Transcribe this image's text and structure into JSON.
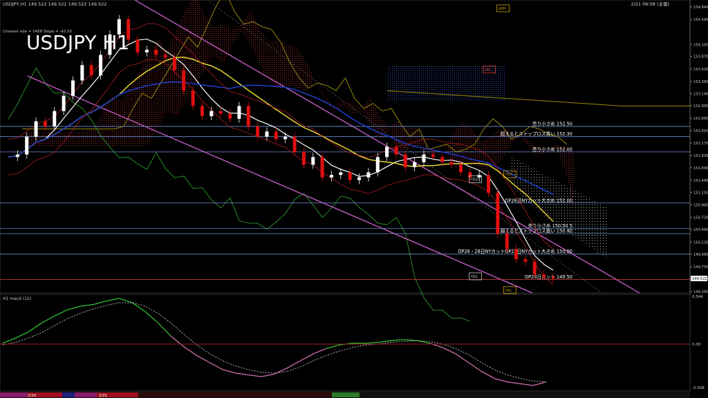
{
  "header": {
    "symbol_info": "USDJPY,H1  149.522 149.522 149.522 149.522",
    "datetime": "2/21 06:08 (主価)",
    "big_title": "USDJPY H1",
    "channel_info": "Channel size = 1458 Slope = -42.55"
  },
  "sub_panel": {
    "label": "H1   macd (12)",
    "ticks": [
      "0.544",
      "0.00",
      "-0.508"
    ]
  },
  "bottom_bar": {
    "dates": [
      "2/20",
      "2/21"
    ]
  },
  "chart_data": [
    {
      "type": "candlestick",
      "symbol": "USDJPY",
      "timeframe": "H1",
      "ylim": [
        149.265,
        154.84
      ],
      "y_ticks": [
        154.84,
        154.595,
        154.105,
        153.87,
        153.625,
        153.38,
        153.14,
        152.905,
        152.66,
        152.415,
        152.175,
        151.93,
        151.69,
        151.445,
        151.21,
        150.965,
        150.72,
        150.48,
        150.235,
        149.995,
        149.75,
        149.522,
        149.265
      ],
      "y_tick_labels": [
        "154.840",
        "154.595",
        "154.105",
        "153.870",
        "153.625",
        "153.380",
        "153.140",
        "152.905",
        "152.660",
        "152.415",
        "152.175",
        "151.930",
        "151.690",
        "151.445",
        "151.210",
        "150.965",
        "150.720",
        "150.480",
        "150.235",
        "149.995",
        "149.750",
        "149.522",
        "149.265"
      ],
      "current_price": 149.522,
      "price_path": [
        151.9,
        151.95,
        152.3,
        152.6,
        152.5,
        152.8,
        153.1,
        153.4,
        153.7,
        153.5,
        153.9,
        154.3,
        154.6,
        154.2,
        153.95,
        154.0,
        153.9,
        153.85,
        153.6,
        153.2,
        152.9,
        152.7,
        152.8,
        152.75,
        152.65,
        152.9,
        152.5,
        152.3,
        152.4,
        152.25,
        152.3,
        152.0,
        151.75,
        151.9,
        151.5,
        151.55,
        151.6,
        151.45,
        151.5,
        151.6,
        151.9,
        152.1,
        151.95,
        151.7,
        151.8,
        151.95,
        151.9,
        151.8,
        151.75,
        151.6,
        151.5,
        151.55,
        151.2,
        150.4,
        150.1,
        149.9,
        149.85,
        149.6,
        149.55,
        149.52
      ],
      "levels": [
        {
          "price": 152.5,
          "label": "売り小さめ 152.50",
          "color": "#6e8fd8"
        },
        {
          "price": 152.3,
          "label": "超えるとストップロス買い 152.30",
          "color": "#6e8fd8"
        },
        {
          "price": 152.0,
          "label": "売り小さめ 152.00",
          "color": "#6e8fd8"
        },
        {
          "price": 151.0,
          "label": "OP26日NYカット大きめ 151.00",
          "color": "#6e8fd8"
        },
        {
          "price": 150.5,
          "label": "売り小さめ 150.50  5",
          "color": "#6e8fd8"
        },
        {
          "price": 150.4,
          "label": "超えるとストップロス買い 150.40",
          "color": "#6e8fd8"
        },
        {
          "price": 150.0,
          "label": "OP26・28日NYカットOP27日NYカット大きめ 150.00",
          "color": "#6e8fd8"
        },
        {
          "price": 149.5,
          "label": "OP28日カット 149.50",
          "color": "#e04040"
        }
      ],
      "box_labels": [
        {
          "text": "LWH",
          "price": 154.8,
          "x_frac": 0.72,
          "color": "#c8a000"
        },
        {
          "text": "LWL",
          "price": 153.6,
          "x_frac": 0.7,
          "color": "#e04040"
        },
        {
          "text": "YDH",
          "price": 151.55,
          "x_frac": 0.73,
          "color": "#c8a000"
        },
        {
          "text": "YDO",
          "price": 151.45,
          "x_frac": 0.68,
          "color": "#cccccc"
        },
        {
          "text": "YDC",
          "price": 149.55,
          "x_frac": 0.68,
          "color": "#cccccc"
        },
        {
          "text": "YDL",
          "price": 149.28,
          "x_frac": 0.73,
          "color": "#c8a000"
        }
      ]
    },
    {
      "type": "line",
      "name": "macd (12)",
      "ylim": [
        -0.508,
        0.544
      ],
      "series": [
        {
          "values": [
            0.02,
            0.08,
            0.15,
            0.25,
            0.33,
            0.4,
            0.44,
            0.46,
            0.5,
            0.53,
            0.48,
            0.38,
            0.25,
            0.1,
            -0.02,
            -0.12,
            -0.2,
            -0.28,
            -0.32,
            -0.34,
            -0.36,
            -0.33,
            -0.26,
            -0.18,
            -0.1,
            -0.04,
            0.0,
            0.02,
            0.02,
            0.03,
            0.05,
            0.06,
            0.05,
            0.02,
            -0.03,
            -0.1,
            -0.2,
            -0.3,
            -0.38,
            -0.42,
            -0.44,
            -0.46,
            -0.42
          ]
        },
        {
          "values": [
            0.0,
            0.03,
            0.08,
            0.14,
            0.22,
            0.3,
            0.36,
            0.41,
            0.45,
            0.48,
            0.48,
            0.44,
            0.36,
            0.25,
            0.12,
            0.0,
            -0.1,
            -0.18,
            -0.24,
            -0.28,
            -0.31,
            -0.32,
            -0.3,
            -0.25,
            -0.18,
            -0.12,
            -0.07,
            -0.03,
            0.0,
            0.01,
            0.03,
            0.04,
            0.05,
            0.04,
            0.01,
            -0.04,
            -0.11,
            -0.2,
            -0.28,
            -0.34,
            -0.38,
            -0.41,
            -0.42
          ]
        }
      ]
    }
  ]
}
